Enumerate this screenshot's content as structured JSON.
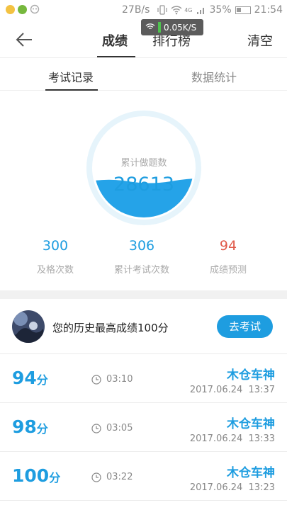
{
  "status_bar": {
    "speed": "27B/s",
    "network": "4G",
    "battery": "35%",
    "time": "21:54"
  },
  "net_overlay": {
    "speed": "0.05K/S"
  },
  "header": {
    "tabs": [
      {
        "label": "成绩",
        "active": true
      },
      {
        "label": "排行榜",
        "active": false
      }
    ],
    "clear_label": "清空"
  },
  "subtabs": [
    {
      "label": "考试记录",
      "active": true
    },
    {
      "label": "数据统计",
      "active": false
    }
  ],
  "summary": {
    "gauge_title": "累计做题数",
    "gauge_value": "28613",
    "stats": [
      {
        "value": "300",
        "label": "及格次数"
      },
      {
        "value": "306",
        "label": "累计考试次数"
      },
      {
        "value": "94",
        "label": "成绩预测"
      }
    ]
  },
  "best": {
    "text": "您的历史最高成绩100分",
    "button_label": "去考试"
  },
  "records": [
    {
      "score": "94",
      "unit": "分",
      "duration": "03:10",
      "title": "木仓车神",
      "date": "2017.06.24  13:37"
    },
    {
      "score": "98",
      "unit": "分",
      "duration": "03:05",
      "title": "木仓车神",
      "date": "2017.06.24  13:33"
    },
    {
      "score": "100",
      "unit": "分",
      "duration": "03:22",
      "title": "木仓车神",
      "date": "2017.06.24  13:23"
    }
  ],
  "colors": {
    "accent": "#1e9de0",
    "prediction": "#e05a4a",
    "gauge_ring": "#e6f4fb"
  }
}
